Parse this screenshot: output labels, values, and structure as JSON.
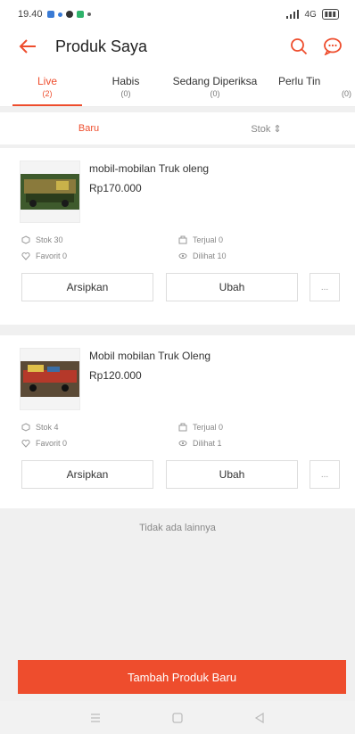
{
  "status_bar": {
    "time": "19.40",
    "signal": "4G"
  },
  "header": {
    "title": "Produk Saya"
  },
  "colors": {
    "accent": "#ee4d2d"
  },
  "tabs": [
    {
      "label": "Live",
      "count": "(2)"
    },
    {
      "label": "Habis",
      "count": "(0)"
    },
    {
      "label": "Sedang Diperiksa",
      "count": "(0)"
    },
    {
      "label": "Perlu Tin",
      "count": "(0)"
    }
  ],
  "sort": {
    "new": "Baru",
    "stock": "Stok ⇕"
  },
  "products": [
    {
      "name": "mobil-mobilan Truk oleng",
      "price": "Rp170.000",
      "stock": "Stok 30",
      "sold": "Terjual 0",
      "favorite": "Favorit 0",
      "views": "Dilihat 10",
      "archive": "Arsipkan",
      "edit": "Ubah",
      "more": "..."
    },
    {
      "name": "Mobil mobilan Truk Oleng",
      "price": "Rp120.000",
      "stock": "Stok 4",
      "sold": "Terjual 0",
      "favorite": "Favorit 0",
      "views": "Dilihat 1",
      "archive": "Arsipkan",
      "edit": "Ubah",
      "more": "..."
    }
  ],
  "end_text": "Tidak ada lainnya",
  "add_button": "Tambah Produk Baru",
  "icons": [
    "back-arrow-icon",
    "search-icon",
    "chat-icon",
    "stock-icon",
    "sold-icon",
    "heart-icon",
    "eye-icon",
    "menu-icon",
    "home-icon",
    "back-icon"
  ]
}
